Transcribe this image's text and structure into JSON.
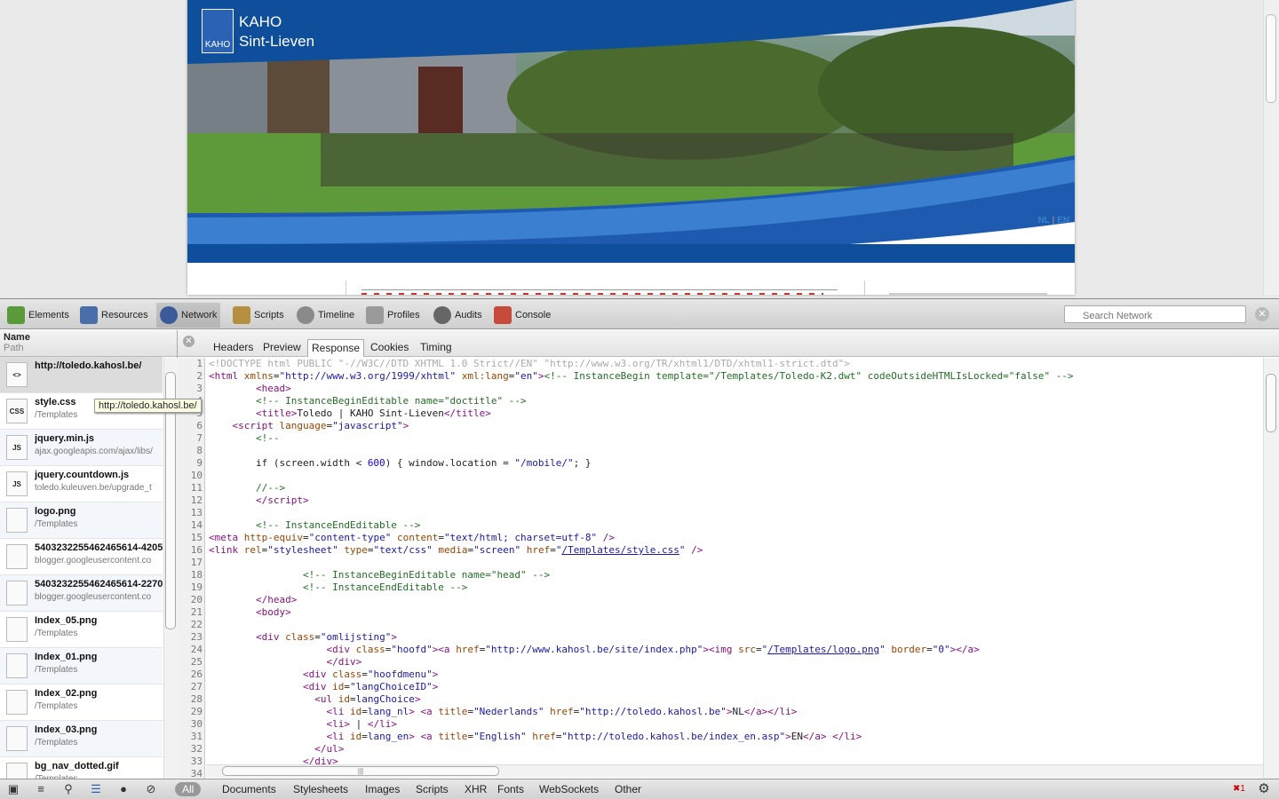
{
  "site": {
    "logo_text": "KAHO",
    "title_line1": "KAHO",
    "title_line2": "Sint-Lieven",
    "lang_nl": "NL",
    "lang_sep": "|",
    "lang_en": "EN"
  },
  "toolbar": {
    "panels": [
      "Elements",
      "Resources",
      "Network",
      "Scripts",
      "Timeline",
      "Profiles",
      "Audits",
      "Console"
    ],
    "selected": "Network",
    "search_placeholder": "Search Network"
  },
  "sidebar": {
    "col_name": "Name",
    "col_path": "Path",
    "tooltip": "http://toledo.kahosl.be/",
    "requests": [
      {
        "name": "http://toledo.kahosl.be/",
        "path": "",
        "icon": "html-icon"
      },
      {
        "name": "style.css",
        "path": "/Templates",
        "icon": "css-icon"
      },
      {
        "name": "jquery.min.js",
        "path": "ajax.googleapis.com/ajax/libs/",
        "icon": "js-icon"
      },
      {
        "name": "jquery.countdown.js",
        "path": "toledo.kuleuven.be/upgrade_t",
        "icon": "js-icon"
      },
      {
        "name": "logo.png",
        "path": "/Templates",
        "icon": "image-icon"
      },
      {
        "name": "5403232255462465614-4205",
        "path": "blogger.googleusercontent.co",
        "icon": "file-icon"
      },
      {
        "name": "5403232255462465614-2270",
        "path": "blogger.googleusercontent.co",
        "icon": "file-icon"
      },
      {
        "name": "Index_05.png",
        "path": "/Templates",
        "icon": "image-icon"
      },
      {
        "name": "Index_01.png",
        "path": "/Templates",
        "icon": "image-icon"
      },
      {
        "name": "Index_02.png",
        "path": "/Templates",
        "icon": "image-icon"
      },
      {
        "name": "Index_03.png",
        "path": "/Templates",
        "icon": "image-icon"
      },
      {
        "name": "bg_nav_dotted.gif",
        "path": "/Templates",
        "icon": "image-icon"
      }
    ]
  },
  "detail_tabs": {
    "items": [
      "Headers",
      "Preview",
      "Response",
      "Cookies",
      "Timing"
    ],
    "selected": "Response"
  },
  "status": {
    "filters": [
      "All",
      "Documents",
      "Stylesheets",
      "Images",
      "Scripts",
      "XHR",
      "Fonts",
      "WebSockets",
      "Other"
    ],
    "selected": "All",
    "error_count": "1"
  },
  "colors": {
    "accent": "#0f4e9b",
    "banner_blue": "#3a7fd0"
  }
}
